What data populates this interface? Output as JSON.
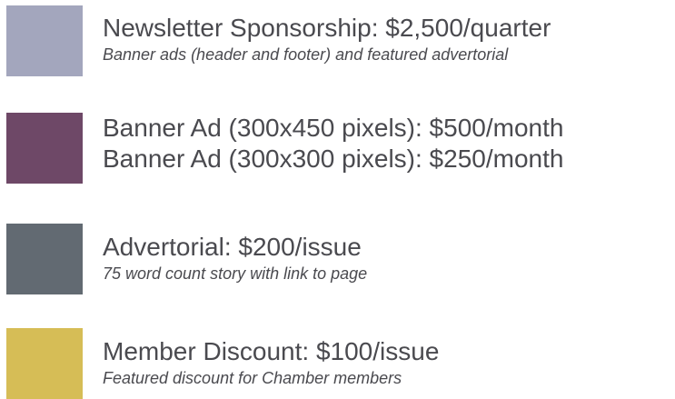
{
  "items": [
    {
      "color": "#a3a6bd",
      "title": "Newsletter Sponsorship: $2,500/quarter",
      "subtitle": "Banner ads (header and footer) and featured advertorial"
    },
    {
      "color": "#6e4867",
      "title": "Banner Ad (300x450 pixels): $500/month",
      "title2": "Banner Ad (300x300 pixels): $250/month"
    },
    {
      "color": "#626a72",
      "title": "Advertorial: $200/issue",
      "subtitle": "75 word count story with link to page"
    },
    {
      "color": "#d6bd56",
      "title": "Member Discount: $100/issue",
      "subtitle": "Featured discount for Chamber members"
    }
  ]
}
